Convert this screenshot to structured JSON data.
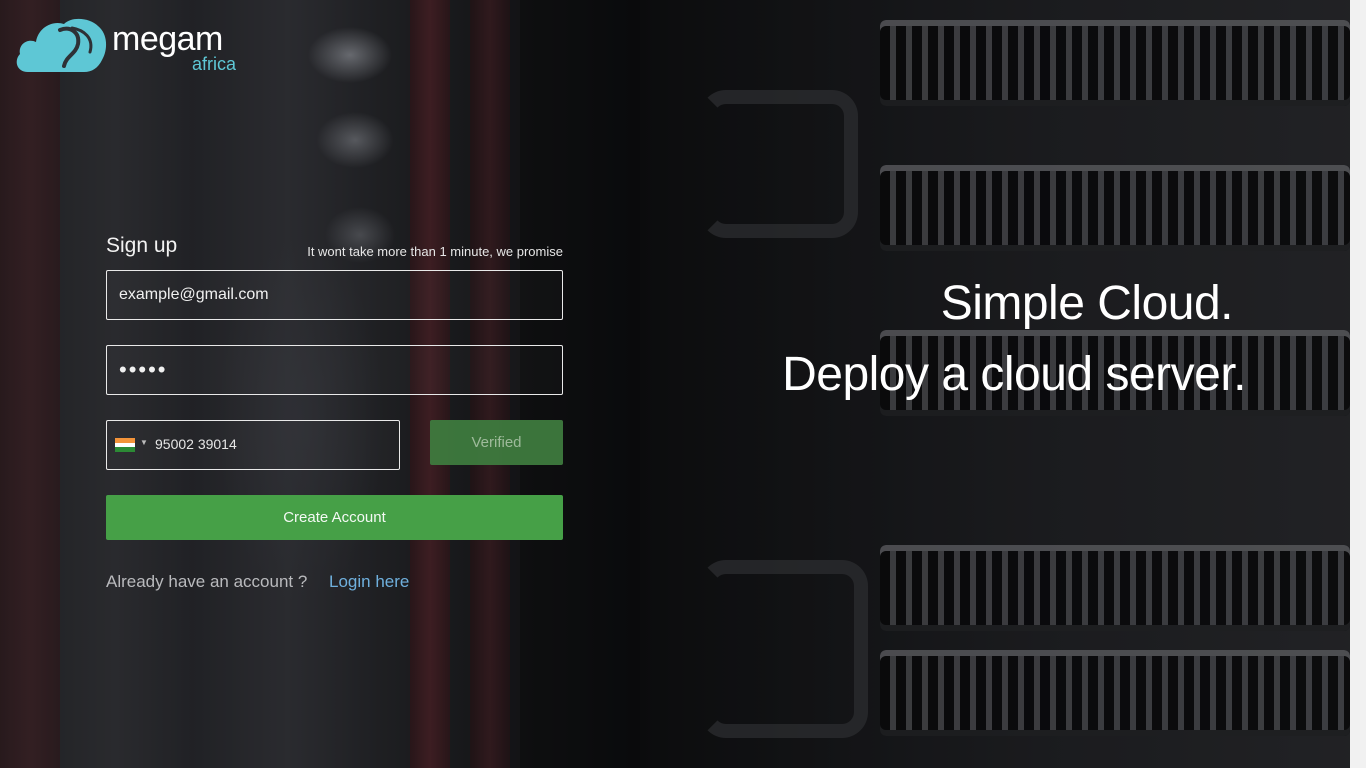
{
  "brand": {
    "name": "megam",
    "sub": "africa",
    "accent_color": "#5ec7d5"
  },
  "signup": {
    "title": "Sign up",
    "note": "It wont take more than 1 minute, we promise",
    "email_value": "example@gmail.com",
    "password_value": "•••••",
    "phone": {
      "country_flag": "india-flag-icon",
      "number": "95002 39014"
    },
    "verified_label": "Verified",
    "create_label": "Create Account",
    "already_text": "Already have an account ?",
    "login_label": "Login here"
  },
  "headline": {
    "line1": "Simple Cloud.",
    "line2": "Deploy a cloud server."
  },
  "colors": {
    "primary_button": "#46a047",
    "verified_button": "#3f7d3f",
    "link": "#6fb0dd"
  }
}
